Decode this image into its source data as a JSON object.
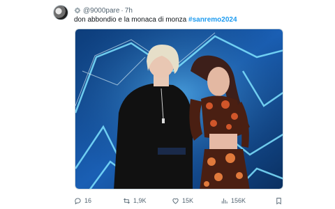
{
  "tweet": {
    "handle": "@9000pare",
    "separator": "·",
    "time": "7h",
    "text": "don abbondio e la monaca di monza",
    "hashtag": "#sanremo2024",
    "media": {
      "type": "video-still",
      "description_icon": "photo"
    },
    "stats": {
      "replies": "16",
      "retweets": "1,9K",
      "likes": "15K",
      "views": "156K"
    }
  },
  "icons": {
    "badge": "flower-badge-icon",
    "reply": "reply-icon",
    "retweet": "retweet-icon",
    "like": "heart-icon",
    "views": "views-bar-chart-icon",
    "bookmark": "bookmark-icon"
  },
  "colors": {
    "accent": "#1d9bf0",
    "muted": "#536471",
    "text": "#0f1419"
  }
}
